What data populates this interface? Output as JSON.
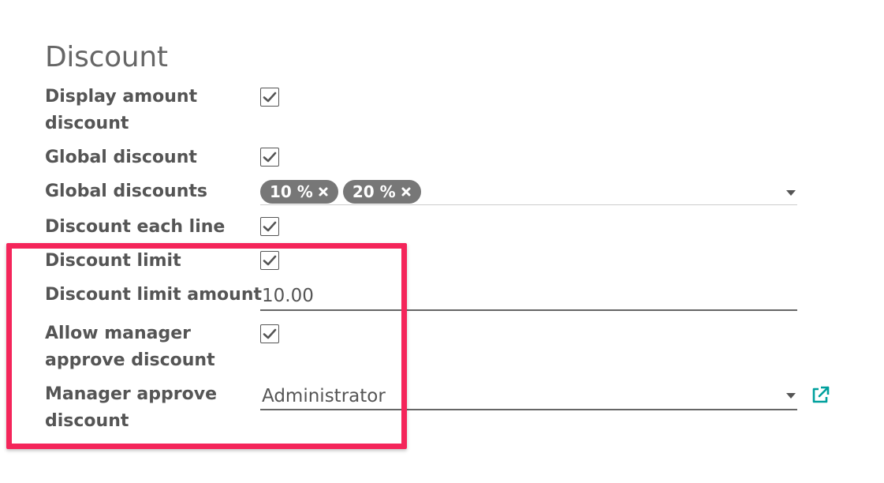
{
  "section": {
    "title": "Discount"
  },
  "fields": {
    "display_amount_discount": {
      "label_line1": "Display amount",
      "label_line2": "discount",
      "checked": true
    },
    "global_discount": {
      "label": "Global discount",
      "checked": true
    },
    "global_discounts": {
      "label": "Global discounts",
      "tags": [
        "10 %",
        "20 %"
      ]
    },
    "discount_each_line": {
      "label": "Discount each line",
      "checked": true
    },
    "discount_limit": {
      "label": "Discount limit",
      "checked": true
    },
    "discount_limit_amount": {
      "label": "Discount limit amount",
      "value": "10.00"
    },
    "allow_manager_approve": {
      "label_line1": "Allow manager",
      "label_line2": "approve discount",
      "checked": true
    },
    "manager_approve": {
      "label_line1": "Manager approve",
      "label_line2": "discount",
      "value": "Administrator"
    }
  },
  "icons": {
    "checkbox_check": "check-icon",
    "tag_remove": "close-icon",
    "dropdown": "caret-down-icon",
    "open_record": "external-link-icon"
  },
  "colors": {
    "highlight_border": "#f4255a",
    "tag_background": "#777777",
    "external_link": "#00a09d"
  }
}
